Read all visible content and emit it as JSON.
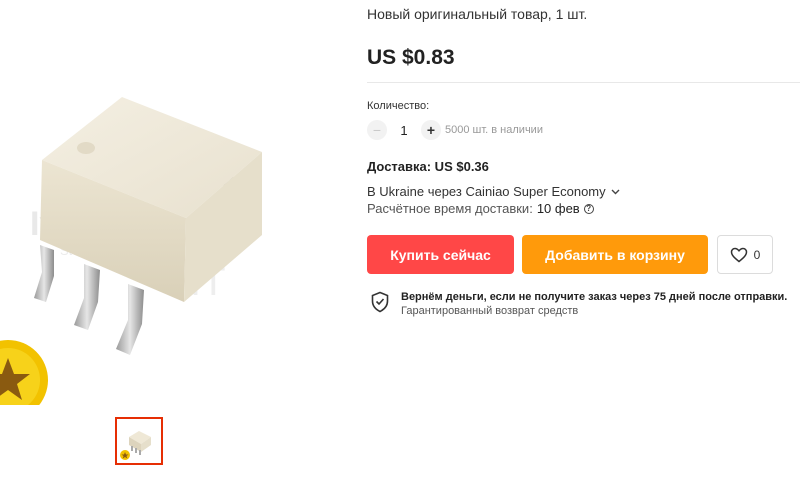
{
  "product": {
    "subtitle": "Новый оригинальный товар, 1 шт.",
    "price": "US $0.83"
  },
  "gallery": {
    "image_icon": "optocoupler-chip-image",
    "thumbnail_icon": "chip-thumbnail",
    "badge_icon": "gold-star-badge"
  },
  "quantity": {
    "label": "Количество:",
    "minus": "−",
    "value": "1",
    "plus": "+",
    "stock": "5000 шт. в наличии"
  },
  "shipping": {
    "title": "Доставка: US $0.36",
    "route": "В Ukraine через Cainiao Super Economy",
    "eta_label": "Расчётное время доставки:",
    "eta_date": "10 фев",
    "help_glyph": "?"
  },
  "actions": {
    "buy_now": "Купить сейчас",
    "add_to_cart": "Добавить в корзину",
    "wishlist_count": "0"
  },
  "guarantee": {
    "title": "Вернём деньги, если не получите заказ через 75 дней после отправки.",
    "subtitle": "Гарантированный возврат средств"
  },
  "colors": {
    "buy": "#ff4747",
    "cart": "#ff9a0b",
    "thumb_border": "#e62e04"
  }
}
